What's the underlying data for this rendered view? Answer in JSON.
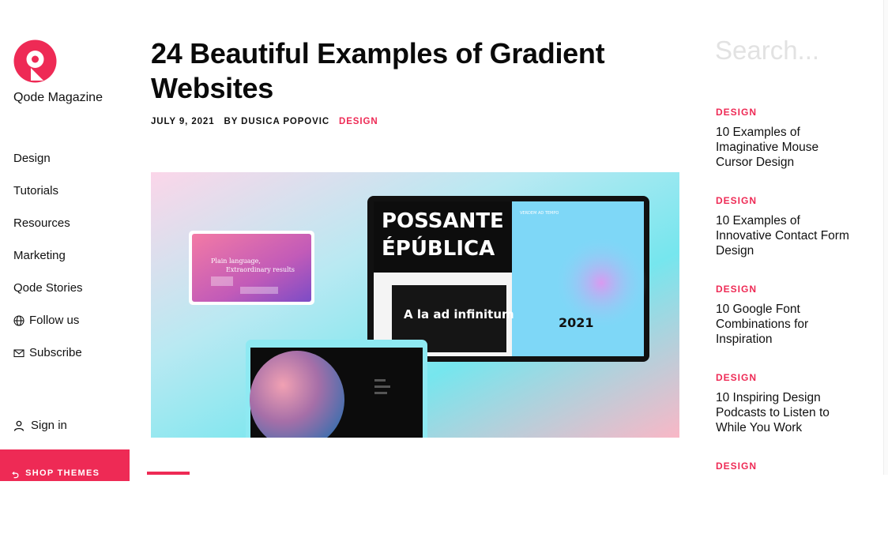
{
  "brand": {
    "name": "Qode Magazine",
    "logo_icon": "qode-logo-icon",
    "accent": "#ee2a55"
  },
  "nav": {
    "items": [
      {
        "label": "Design"
      },
      {
        "label": "Tutorials"
      },
      {
        "label": "Resources"
      },
      {
        "label": "Marketing"
      },
      {
        "label": "Qode Stories"
      },
      {
        "label": "Follow us",
        "icon": "globe-icon"
      },
      {
        "label": "Subscribe",
        "icon": "envelope-icon"
      }
    ],
    "signin": {
      "label": "Sign in",
      "icon": "user-icon"
    },
    "shop": {
      "label": "SHOP THEMES",
      "icon": "arrow-left-icon"
    }
  },
  "article": {
    "title": "24 Beautiful Examples of Gradient Websites",
    "date": "JULY 9, 2021",
    "author": "BY DUSICA POPOVIC",
    "category": "DESIGN",
    "hero": {
      "card_heading": "Plain language, Extraordinary results",
      "poster_title": "POSSANTE ÉPÚBLICA",
      "poster_banner": "A la ad infinitum",
      "poster_year": "2021"
    }
  },
  "search": {
    "placeholder": "Search..."
  },
  "sidebar_posts": [
    {
      "category": "DESIGN",
      "title": "10 Examples of Imaginative Mouse Cursor Design"
    },
    {
      "category": "DESIGN",
      "title": "10 Examples of Innovative Contact Form Design"
    },
    {
      "category": "DESIGN",
      "title": "10 Google Font Combinations for Inspiration"
    },
    {
      "category": "DESIGN",
      "title": "10 Inspiring Design Podcasts to Listen to While You Work"
    },
    {
      "category": "DESIGN",
      "title": ""
    }
  ]
}
